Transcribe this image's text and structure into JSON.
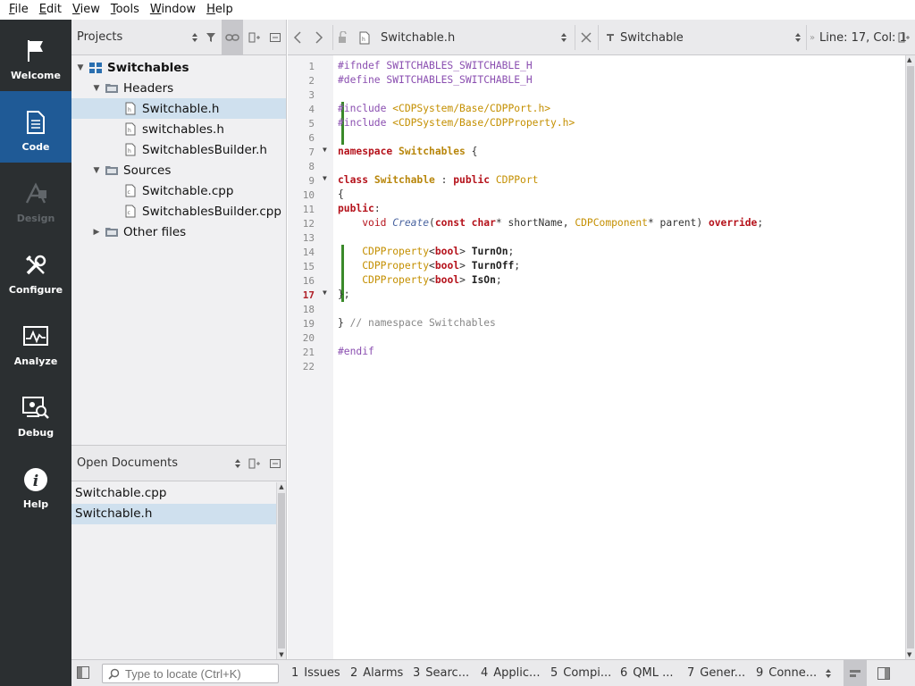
{
  "menu": [
    {
      "label": "File",
      "u": "F",
      "rest": "ile"
    },
    {
      "label": "Edit",
      "u": "E",
      "rest": "dit"
    },
    {
      "label": "View",
      "u": "V",
      "rest": "iew"
    },
    {
      "label": "Tools",
      "u": "T",
      "rest": "ools"
    },
    {
      "label": "Window",
      "u": "W",
      "rest": "indow"
    },
    {
      "label": "Help",
      "u": "H",
      "rest": "elp"
    }
  ],
  "modes": [
    {
      "label": "Welcome",
      "icon": "flag-icon",
      "state": "normal"
    },
    {
      "label": "Code",
      "icon": "document-icon",
      "state": "active"
    },
    {
      "label": "Design",
      "icon": "design-icon",
      "state": "disabled"
    },
    {
      "label": "Configure",
      "icon": "wrench-icon",
      "state": "normal"
    },
    {
      "label": "Analyze",
      "icon": "analyze-icon",
      "state": "normal"
    },
    {
      "label": "Debug",
      "icon": "debug-icon",
      "state": "normal"
    },
    {
      "label": "Help",
      "icon": "info-icon",
      "state": "normal"
    }
  ],
  "projects": {
    "selector_label": "Projects",
    "tree": [
      {
        "label": "Switchables",
        "level": 0,
        "arrow": "down",
        "icon": "project-icon",
        "bold": true
      },
      {
        "label": "Headers",
        "level": 1,
        "arrow": "down",
        "icon": "folder-icon"
      },
      {
        "label": "Switchable.h",
        "level": 2,
        "icon": "header-file-icon",
        "selected": true
      },
      {
        "label": "switchables.h",
        "level": 2,
        "icon": "header-file-icon"
      },
      {
        "label": "SwitchablesBuilder.h",
        "level": 2,
        "icon": "header-file-icon"
      },
      {
        "label": "Sources",
        "level": 1,
        "arrow": "down",
        "icon": "folder-icon"
      },
      {
        "label": "Switchable.cpp",
        "level": 2,
        "icon": "source-file-icon"
      },
      {
        "label": "SwitchablesBuilder.cpp",
        "level": 2,
        "icon": "source-file-icon"
      },
      {
        "label": "Other files",
        "level": 1,
        "arrow": "right",
        "icon": "folder-icon"
      }
    ]
  },
  "open_documents": {
    "selector_label": "Open Documents",
    "items": [
      {
        "label": "Switchable.cpp"
      },
      {
        "label": "Switchable.h",
        "selected": true
      }
    ]
  },
  "editor_toolbar": {
    "file_name": "Switchable.h",
    "symbol": "Switchable",
    "position": "Line: 17, Col: 1"
  },
  "editor": {
    "current_line": 17,
    "fold_lines": [
      7,
      9,
      17
    ],
    "changed_lines": [
      4,
      5,
      6,
      14,
      15,
      16,
      17
    ],
    "lines": [
      [
        [
          "pp",
          "#ifndef SWITCHABLES_SWITCHABLE_H"
        ]
      ],
      [
        [
          "pp",
          "#define SWITCHABLES_SWITCHABLE_H"
        ]
      ],
      [],
      [
        [
          "pp",
          "#include "
        ],
        [
          "str",
          "<CDPSystem/Base/CDPPort.h>"
        ]
      ],
      [
        [
          "pp",
          "#include "
        ],
        [
          "str",
          "<CDPSystem/Base/CDPProperty.h>"
        ]
      ],
      [],
      [
        [
          "kw",
          "namespace "
        ],
        [
          "tyb",
          "Switchables"
        ],
        [
          "pl",
          " {"
        ]
      ],
      [],
      [
        [
          "kw",
          "class "
        ],
        [
          "tyb",
          "Switchable"
        ],
        [
          "pl",
          " : "
        ],
        [
          "kw",
          "public "
        ],
        [
          "ty",
          "CDPPort"
        ]
      ],
      [
        [
          "pl",
          "{"
        ]
      ],
      [
        [
          "kw",
          "public"
        ],
        [
          "pl",
          ":"
        ]
      ],
      [
        [
          "pl",
          "    "
        ],
        [
          "kwn",
          "void "
        ],
        [
          "fn",
          "Create"
        ],
        [
          "pl",
          "("
        ],
        [
          "kw",
          "const "
        ],
        [
          "kw",
          "char"
        ],
        [
          "pl",
          "* shortName, "
        ],
        [
          "ty",
          "CDPComponent"
        ],
        [
          "pl",
          "* parent) "
        ],
        [
          "kw",
          "override"
        ],
        [
          "pl",
          ";"
        ]
      ],
      [],
      [
        [
          "pl",
          "    "
        ],
        [
          "ty",
          "CDPProperty"
        ],
        [
          "pl",
          "<"
        ],
        [
          "kw",
          "bool"
        ],
        [
          "pl",
          "> "
        ],
        [
          "idb",
          "TurnOn"
        ],
        [
          "pl",
          ";"
        ]
      ],
      [
        [
          "pl",
          "    "
        ],
        [
          "ty",
          "CDPProperty"
        ],
        [
          "pl",
          "<"
        ],
        [
          "kw",
          "bool"
        ],
        [
          "pl",
          "> "
        ],
        [
          "idb",
          "TurnOff"
        ],
        [
          "pl",
          ";"
        ]
      ],
      [
        [
          "pl",
          "    "
        ],
        [
          "ty",
          "CDPProperty"
        ],
        [
          "pl",
          "<"
        ],
        [
          "kw",
          "bool"
        ],
        [
          "pl",
          "> "
        ],
        [
          "idb",
          "IsOn"
        ],
        [
          "pl",
          ";"
        ]
      ],
      [
        [
          "pl",
          "};"
        ]
      ],
      [],
      [
        [
          "pl",
          "} "
        ],
        [
          "cm",
          "// namespace Switchables"
        ]
      ],
      [],
      [
        [
          "pp",
          "#endif"
        ]
      ],
      []
    ]
  },
  "bottom": {
    "locator_placeholder": "Type to locate (Ctrl+K)",
    "panes": [
      {
        "num": "1",
        "label": "Issues"
      },
      {
        "num": "2",
        "label": "Alarms"
      },
      {
        "num": "3",
        "label": "Searc..."
      },
      {
        "num": "4",
        "label": "Applic..."
      },
      {
        "num": "5",
        "label": "Compi..."
      },
      {
        "num": "6",
        "label": "QML ..."
      },
      {
        "num": "7",
        "label": "Gener..."
      },
      {
        "num": "9",
        "label": "Conne..."
      }
    ]
  },
  "colors": {
    "mode_bar": "#2b2f31",
    "mode_active": "#1f5a96",
    "selection": "#cfe0ee",
    "keyword": "#b5121b",
    "preprocessor": "#8a4eb0",
    "type": "#c48f00",
    "change_marker": "#3a8a2a"
  }
}
